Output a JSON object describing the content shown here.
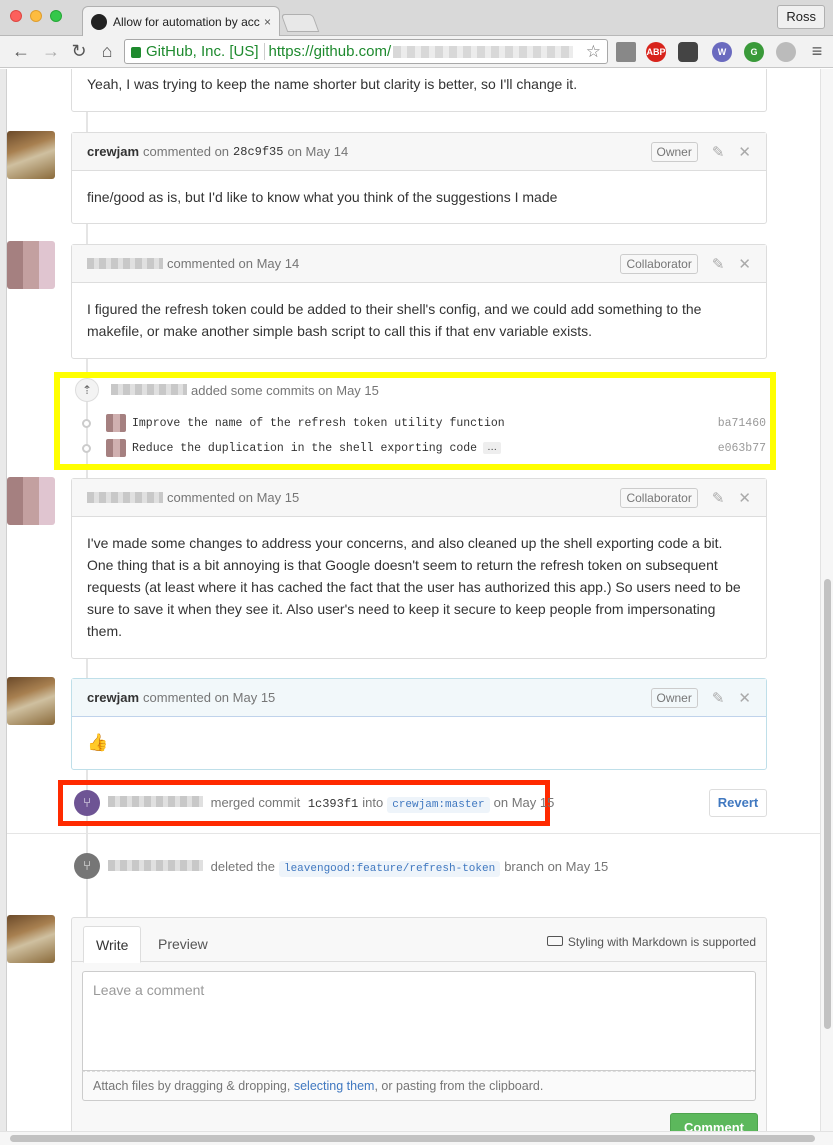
{
  "browser": {
    "tab_title": "Allow for automation by acc",
    "tab_close": "×",
    "profile": "Ross",
    "ev_label": "GitHub, Inc. [US]",
    "url_scheme_host": "https://github.com/",
    "extensions": [
      "ABP",
      "W",
      "G"
    ]
  },
  "nav": {
    "back": "←",
    "forward": "→",
    "reload": "↻",
    "home": "⌂",
    "star": "☆",
    "menu": "≡"
  },
  "comments": [
    {
      "author": "",
      "text": "Yeah, I was trying to keep the name shorter but clarity is better, so I'll change it."
    },
    {
      "author": "crewjam",
      "action": "commented on",
      "sha": "28c9f35",
      "date": "on May 14",
      "role": "Owner",
      "text": "fine/good as is, but I'd like to know what you think of the suggestions I made"
    },
    {
      "author": "",
      "action": "commented on May 14",
      "role": "Collaborator",
      "text": "I figured the refresh token could be added to their shell's config, and we could add something to the makefile, or make another simple bash script to call this if that env variable exists."
    },
    {
      "author": "",
      "action": "commented on May 15",
      "role": "Collaborator",
      "text": "I've made some changes to address your concerns, and also cleaned up the shell exporting code a bit. One thing that is a bit annoying is that Google doesn't seem to return the refresh token on subsequent requests (at least where it has cached the fact that the user has authorized this app.) So users need to be sure to save it when they see it. Also user's need to keep it secure to keep people from impersonating them."
    },
    {
      "author": "crewjam",
      "action": "commented on May 15",
      "role": "Owner",
      "text": "👍"
    }
  ],
  "commits_event": {
    "text": "added some commits on May 15",
    "commits": [
      {
        "message": "Improve the name of the refresh token utility function",
        "sha": "ba71460"
      },
      {
        "message": "Reduce the duplication in the shell exporting code",
        "sha": "e063b77",
        "more": "…"
      }
    ]
  },
  "merge_event": {
    "prefix": "merged commit",
    "sha": "1c393f1",
    "into": "into",
    "branch": "crewjam:master",
    "date": "on May 15",
    "revert": "Revert"
  },
  "delete_event": {
    "prefix": "deleted the",
    "branch": "leavengood:feature/refresh-token",
    "suffix": "branch on May 15"
  },
  "form": {
    "tab_write": "Write",
    "tab_preview": "Preview",
    "markdown_hint": "Styling with Markdown is supported",
    "placeholder": "Leave a comment",
    "attach_before": "Attach files by dragging & dropping,",
    "attach_link": "selecting them",
    "attach_after": ", or pasting from the clipboard.",
    "submit": "Comment"
  },
  "colors": {
    "highlight_yellow": "#ffff00",
    "highlight_red": "#ff2a00",
    "merge_purple": "#6e5494",
    "link_blue": "#4078c0"
  }
}
